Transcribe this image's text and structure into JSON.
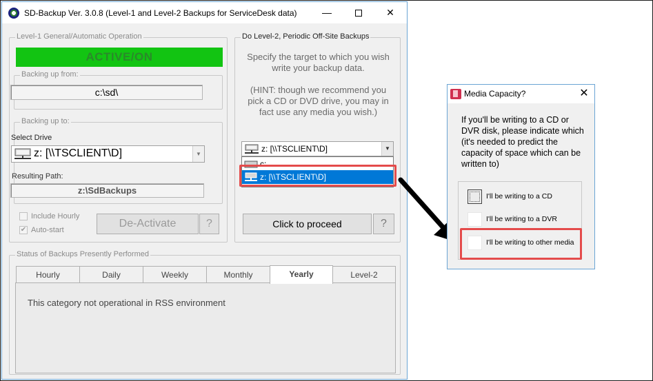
{
  "main_window": {
    "title": "SD-Backup Ver. 3.0.8 (Level-1 and Level-2 Backups for ServiceDesk data)",
    "controls": {
      "minimize": "—",
      "maximize": "",
      "close": "✕"
    }
  },
  "level1": {
    "group_label": "Level-1 General/Automatic Operation",
    "status": "ACTIVE/ON",
    "backing_up_from": {
      "label": "Backing up from:",
      "value": "c:\\sd\\"
    },
    "backing_up_to": {
      "label": "Backing up to:",
      "select_drive_label": "Select Drive",
      "selected_drive": "z: [\\\\TSCLIENT\\D]",
      "resulting_path_label": "Resulting Path:",
      "resulting_path": "z:\\SdBackups"
    },
    "include_hourly": "Include Hourly",
    "auto_start": "Auto-start",
    "auto_start_checked": true,
    "deactivate_button": "De-Activate",
    "help_button": "?"
  },
  "level2": {
    "group_label": "Do Level-2, Periodic Off-Site Backups",
    "instructions": "Specify the target to which you wish write your backup data.",
    "hint": "(HINT: though we recommend you pick a CD or DVD drive, you may in fact use any media you wish.)",
    "selected_drive": "z: [\\\\TSCLIENT\\D]",
    "dropdown_options": [
      "c:",
      "z: [\\\\TSCLIENT\\D]"
    ],
    "highlighted_option_index": 1,
    "proceed_button": "Click to proceed",
    "help_button": "?"
  },
  "status_section": {
    "group_label": "Status of Backups Presently Performed",
    "tabs": [
      "Hourly",
      "Daily",
      "Weekly",
      "Monthly",
      "Yearly",
      "Level-2"
    ],
    "selected_tab_index": 4,
    "message": "This category not operational in RSS environment"
  },
  "dialog": {
    "title": "Media Capacity?",
    "close": "✕",
    "text": "If you'll be writing to a CD or DVR disk, please indicate which (it's needed to predict the capacity of space which can be written to)",
    "options": [
      "I'll be writing to a CD",
      "I'll be writing to a DVR",
      "I'll be writing to other media"
    ]
  },
  "colors": {
    "active_status": "#12c412",
    "highlight": "#e44b4b",
    "selection": "#0078d7"
  }
}
